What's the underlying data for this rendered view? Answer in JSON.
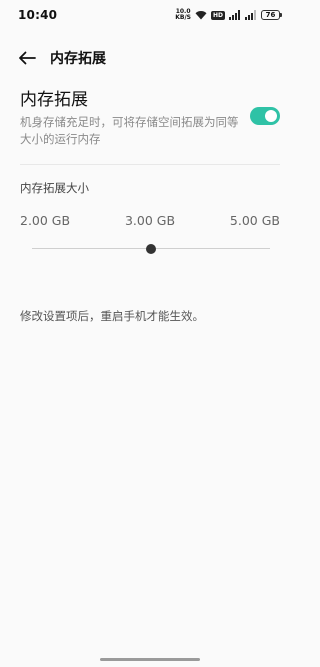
{
  "status_bar": {
    "time": "10:40",
    "net_speed_value": "10.0",
    "net_speed_unit": "KB/S",
    "hd_badge": "HD",
    "battery": "76"
  },
  "header": {
    "title": "内存拓展"
  },
  "expansion": {
    "title": "内存拓展",
    "description": "机身存储充足时，可将存储空间拓展为同等大小的运行内存",
    "enabled": true,
    "accent_color": "#2fc2a6"
  },
  "size_section": {
    "label": "内存拓展大小",
    "options": [
      "2.00 GB",
      "3.00 GB",
      "5.00 GB"
    ],
    "selected_index": 1
  },
  "note": "修改设置项后，重启手机才能生效。"
}
